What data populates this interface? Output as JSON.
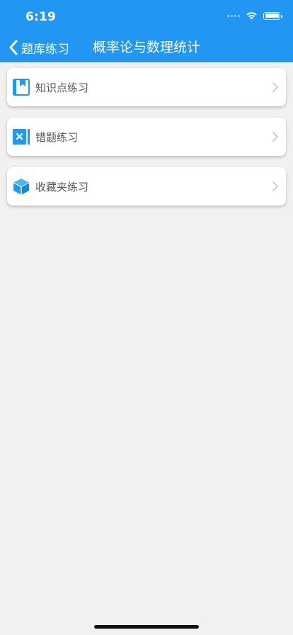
{
  "status_bar": {
    "time": "6:19"
  },
  "nav": {
    "back_label": "题库练习",
    "title": "概率论与数理统计"
  },
  "menu": {
    "items": [
      {
        "label": "知识点练习",
        "icon": "bookmark-book-icon"
      },
      {
        "label": "错题练习",
        "icon": "wrong-x-icon"
      },
      {
        "label": "收藏夹练习",
        "icon": "cube-box-icon"
      }
    ]
  },
  "colors": {
    "header": "#2196f3",
    "icon_blue": "#1e9bf0",
    "background": "#f2f1ef"
  }
}
